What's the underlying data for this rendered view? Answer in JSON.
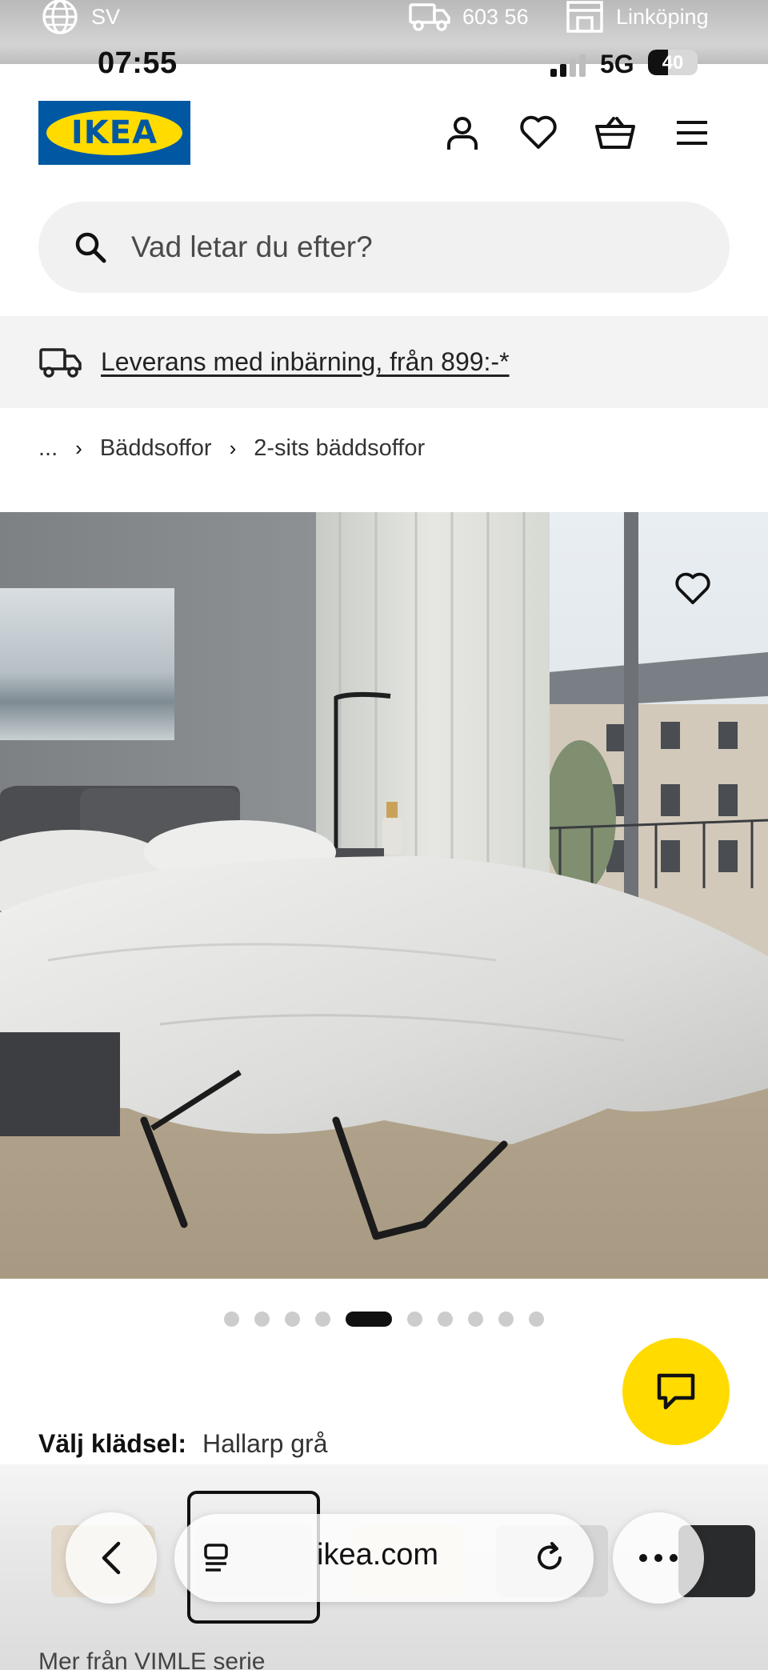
{
  "store_bar": {
    "language": "SV",
    "postal_code": "603 56",
    "store": "Linköping"
  },
  "status_bar": {
    "time": "07:55",
    "network": "5G",
    "battery": "40",
    "battery_level": 0.4
  },
  "header": {
    "logo_text": "IKEA",
    "icons": [
      "user-icon",
      "heart-icon",
      "basket-icon",
      "menu-icon"
    ]
  },
  "search": {
    "placeholder": "Vad letar du efter?"
  },
  "banner": {
    "text": "Leverans med inbärning, från 899:-*"
  },
  "breadcrumb": {
    "ellipsis": "...",
    "items": [
      "Bäddsoffor",
      "2-sits bäddsoffor"
    ]
  },
  "carousel": {
    "total": 10,
    "active_index": 4
  },
  "fabric": {
    "label": "Välj klädsel:",
    "value": "Hallarp grå"
  },
  "more_series": "Mer från VIMLE serie",
  "browser": {
    "domain": "ikea.com"
  },
  "colors": {
    "ikea_blue": "#0058a3",
    "ikea_yellow": "#ffdb00"
  }
}
